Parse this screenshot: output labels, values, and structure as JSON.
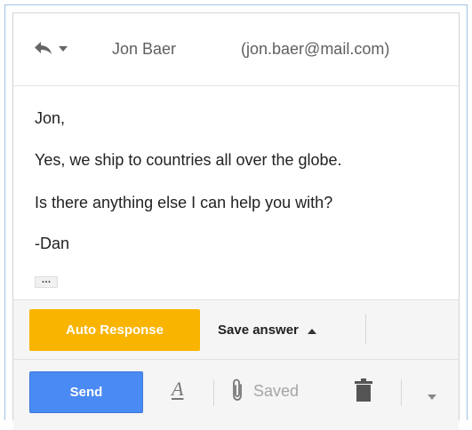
{
  "header": {
    "recipient_name": "Jon Baer",
    "recipient_email": "(jon.baer@mail.com)",
    "reply_icon": "reply-icon",
    "reply_menu_icon": "chevron-down-icon"
  },
  "message": {
    "lines": [
      "Jon,",
      "Yes, we ship to countries all over the globe.",
      "Is there anything else I can help you with?",
      "-Dan"
    ],
    "trimmed_content_label": "…"
  },
  "toolbar_top": {
    "auto_response_label": "Auto Response",
    "save_answer_label": "Save answer",
    "auto_response_color": "#f9b400"
  },
  "toolbar_bottom": {
    "send_label": "Send",
    "format_label": "A",
    "saved_label": "Saved",
    "send_color": "#4a8af4"
  }
}
